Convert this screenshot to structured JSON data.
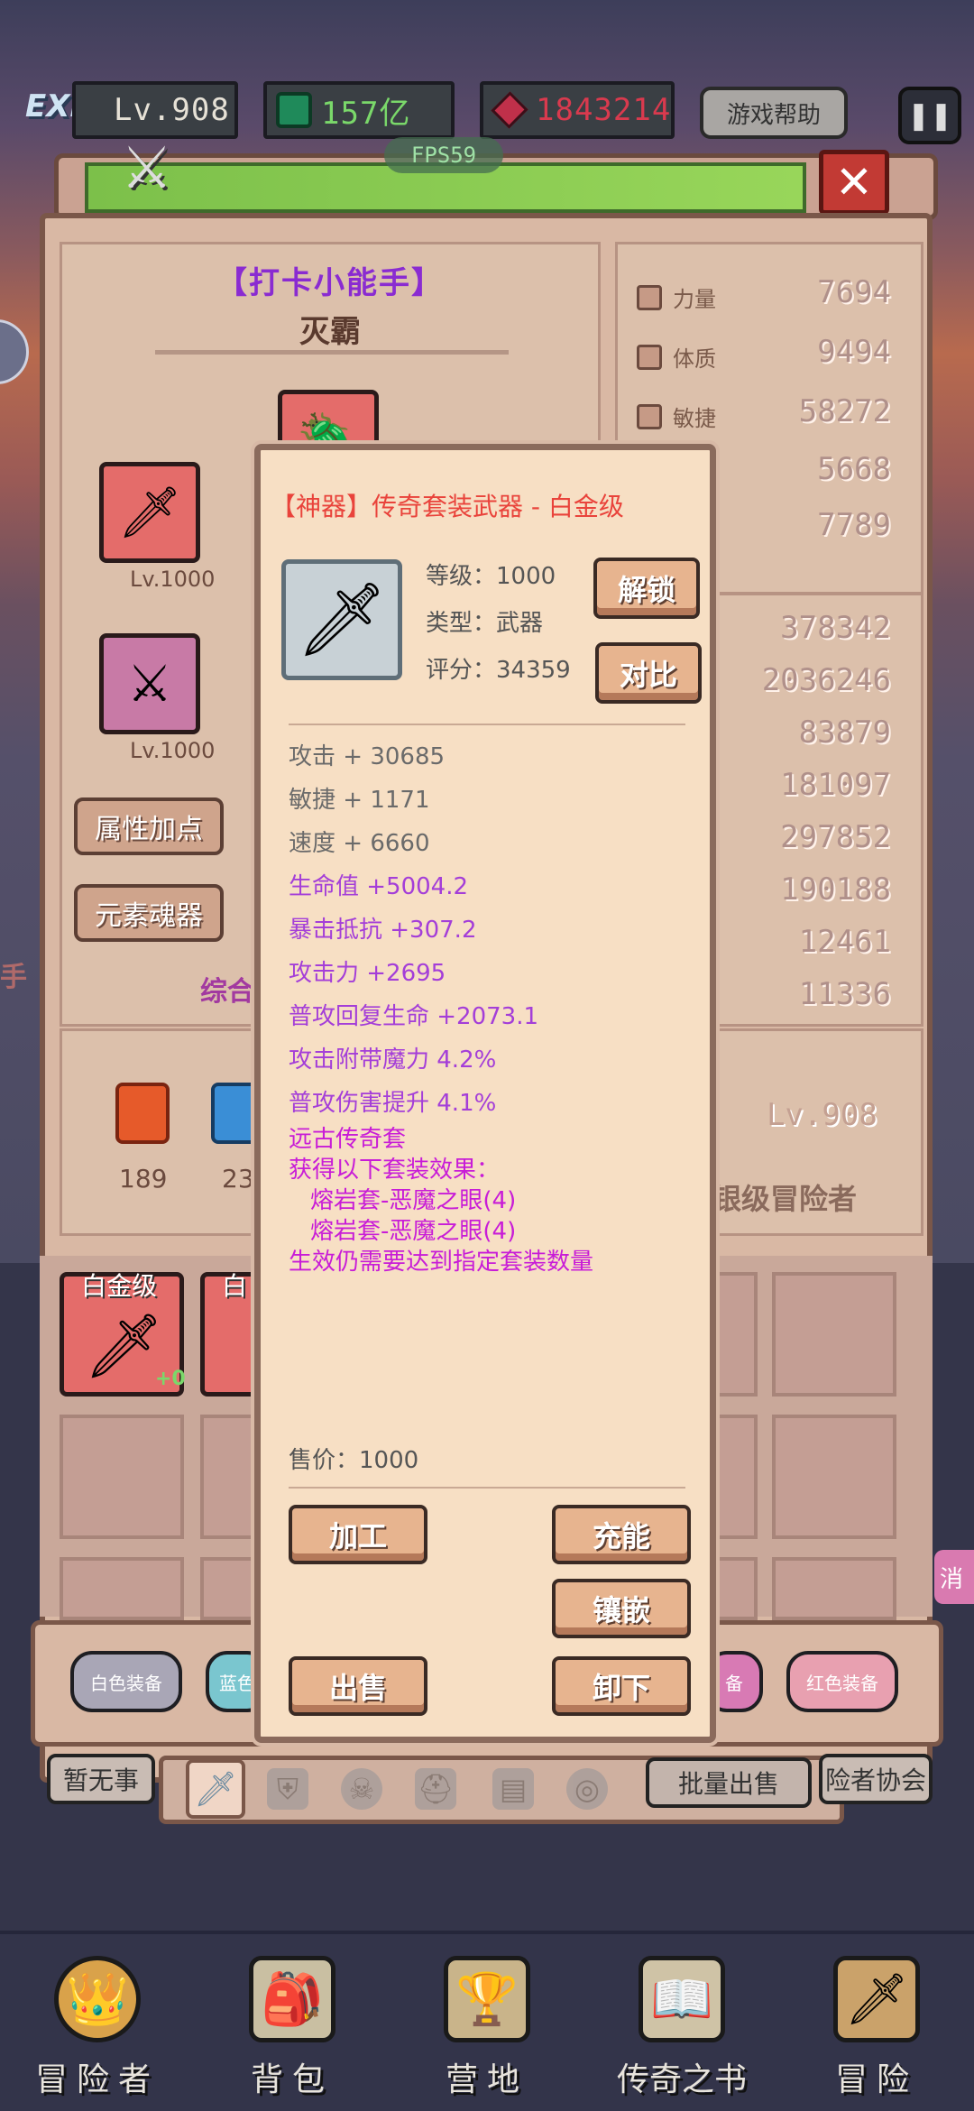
{
  "topbar": {
    "exp_label": "EXP",
    "level": "Lv.908",
    "gems": "157亿",
    "rubies": "1843214",
    "help": "游戏帮助",
    "fps": "FPS59"
  },
  "hero": {
    "title": "【打卡小能手】",
    "name": "灭霸",
    "slot1_level": "Lv.1000",
    "slot2_level": "Lv.1000",
    "btn_attr": "属性加点",
    "btn_soul": "元素魂器",
    "combined_partial": "综合",
    "level_right": "Lv.908",
    "rank_partial": "银级冒险者",
    "side_left_partial": "手"
  },
  "stats": [
    {
      "name": "力量",
      "value": "7694"
    },
    {
      "name": "体质",
      "value": "9494"
    },
    {
      "name": "敏捷",
      "value": "58272"
    },
    {
      "name": "",
      "value": "5668"
    },
    {
      "name": "",
      "value": "7789"
    }
  ],
  "stats2": [
    "378342",
    "2036246",
    "83879",
    "181097",
    "297852",
    "190188",
    "12461",
    "11336"
  ],
  "elements": [
    {
      "count": "189",
      "color": "#e65a2a"
    },
    {
      "count": "23",
      "color": "#3a8ed6"
    }
  ],
  "inventory": {
    "item1_badge": "白金级",
    "item1_plus": "+0",
    "item2_badge": "白"
  },
  "filters": [
    "白色装备",
    "蓝色",
    "备",
    "红色装备"
  ],
  "side_boards": {
    "left": "暂无事",
    "bulk_sell": "批量出售",
    "right": "险者协会",
    "far_right": "消"
  },
  "nav": [
    {
      "label": "冒险者",
      "icon": "helmet-icon"
    },
    {
      "label": "背包",
      "icon": "backpack-icon"
    },
    {
      "label": "营地",
      "icon": "trophy-icon"
    },
    {
      "label": "传奇之书",
      "icon": "book-icon"
    },
    {
      "label": "冒险",
      "icon": "sword-icon"
    }
  ],
  "popup": {
    "title": "【神器】传奇套装武器 - 白金级",
    "level": "等级：1000",
    "type": "类型：武器",
    "score": "评分：34359",
    "btn_unlock": "解锁",
    "btn_compare": "对比",
    "base_stats": [
      "攻击 + 30685",
      "敏捷 + 1171",
      "速度 + 6660"
    ],
    "bonus_stats": [
      "生命值 +5004.2",
      "暴击抵抗 +307.2",
      "攻击力 +2695",
      "普攻回复生命 +2073.1",
      "攻击附带魔力 4.2%",
      "普攻伤害提升 4.1%"
    ],
    "set_lines": [
      "远古传奇套",
      "获得以下套装效果：",
      "熔岩套-恶魔之眼(4)",
      "熔岩套-恶魔之眼(4)",
      "生效仍需要达到指定套装数量"
    ],
    "price": "售价：1000",
    "btn_process": "加工",
    "btn_charge": "充能",
    "btn_inlay": "镶嵌",
    "btn_sell": "出售",
    "btn_unequip": "卸下"
  }
}
